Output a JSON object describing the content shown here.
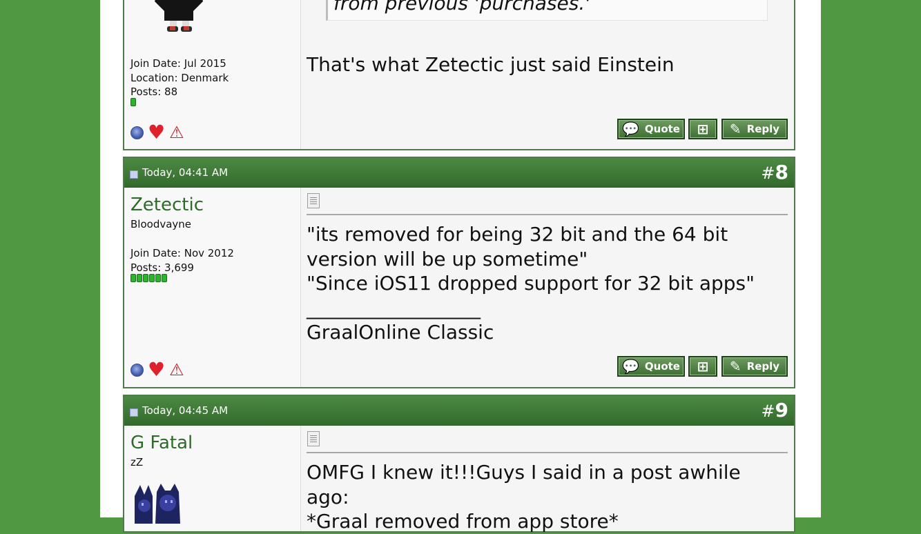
{
  "colors": {
    "background": "#519843",
    "header": "#3f7b36",
    "username": "#2e6a2a"
  },
  "post7": {
    "quote_line": "from previous 'purchases.'",
    "join_date": "Join Date: Jul 2015",
    "location": "Location: Denmark",
    "posts": "Posts: 88",
    "reputation_pips": 1,
    "message": "That's what Zetectic just said Einstein"
  },
  "post8": {
    "date": "Today, 04:41 AM",
    "number_hash": "#",
    "number": "8",
    "username": "Zetectic",
    "user_title": "Bloodvayne",
    "join_date": "Join Date: Nov 2012",
    "posts": "Posts: 3,699",
    "reputation_pips": 6,
    "message_lines": [
      "\"its removed for being 32 bit and the 64 bit",
      "version will be up sometime\"",
      "\"Since iOS11 dropped support for 32 bit apps\"",
      "__________________",
      "GraalOnline Classic"
    ]
  },
  "post9": {
    "date": "Today, 04:45 AM",
    "number_hash": "#",
    "number": "9",
    "username": "G Fatal",
    "user_title": "zZ",
    "message_lines": [
      "OMFG I knew it!!!Guys I said in a post awhile ago:",
      "*Graal removed from app store*"
    ]
  },
  "buttons": {
    "quote": "Quote",
    "reply": "Reply"
  },
  "icons": {
    "online": "online-status-icon",
    "heart": "heart-icon",
    "report": "report-warning-icon",
    "multiquote": "multi-quote-icon",
    "post": "post-icon"
  }
}
